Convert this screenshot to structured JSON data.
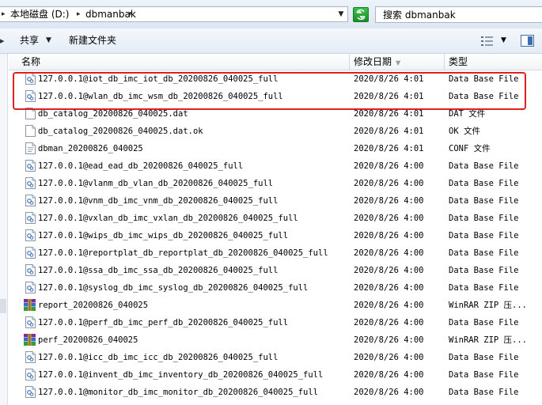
{
  "address": {
    "segments": [
      "本地磁盘 (D:)",
      "dbmanbak"
    ]
  },
  "search": {
    "label": "搜索",
    "query": "dbmanbak"
  },
  "toolbar": {
    "share": "共享",
    "new_folder": "新建文件夹"
  },
  "columns": {
    "name": "名称",
    "date": "修改日期",
    "type": "类型"
  },
  "files": [
    {
      "name": "127.0.0.1@iot_db_imc_iot_db_20200826_040025_full",
      "date": "2020/8/26 4:01",
      "type": "Data Base File",
      "icon": "db-file-icon"
    },
    {
      "name": "127.0.0.1@wlan_db_imc_wsm_db_20200826_040025_full",
      "date": "2020/8/26 4:01",
      "type": "Data Base File",
      "icon": "db-file-icon"
    },
    {
      "name": "db_catalog_20200826_040025.dat",
      "date": "2020/8/26 4:01",
      "type": "DAT 文件",
      "icon": "blank-file-icon"
    },
    {
      "name": "db_catalog_20200826_040025.dat.ok",
      "date": "2020/8/26 4:01",
      "type": "OK 文件",
      "icon": "blank-file-icon"
    },
    {
      "name": "dbman_20200826_040025",
      "date": "2020/8/26 4:01",
      "type": "CONF 文件",
      "icon": "conf-file-icon"
    },
    {
      "name": "127.0.0.1@ead_ead_db_20200826_040025_full",
      "date": "2020/8/26 4:00",
      "type": "Data Base File",
      "icon": "db-file-icon"
    },
    {
      "name": "127.0.0.1@vlanm_db_vlan_db_20200826_040025_full",
      "date": "2020/8/26 4:00",
      "type": "Data Base File",
      "icon": "db-file-icon"
    },
    {
      "name": "127.0.0.1@vnm_db_imc_vnm_db_20200826_040025_full",
      "date": "2020/8/26 4:00",
      "type": "Data Base File",
      "icon": "db-file-icon"
    },
    {
      "name": "127.0.0.1@vxlan_db_imc_vxlan_db_20200826_040025_full",
      "date": "2020/8/26 4:00",
      "type": "Data Base File",
      "icon": "db-file-icon"
    },
    {
      "name": "127.0.0.1@wips_db_imc_wips_db_20200826_040025_full",
      "date": "2020/8/26 4:00",
      "type": "Data Base File",
      "icon": "db-file-icon"
    },
    {
      "name": "127.0.0.1@reportplat_db_reportplat_db_20200826_040025_full",
      "date": "2020/8/26 4:00",
      "type": "Data Base File",
      "icon": "db-file-icon"
    },
    {
      "name": "127.0.0.1@ssa_db_imc_ssa_db_20200826_040025_full",
      "date": "2020/8/26 4:00",
      "type": "Data Base File",
      "icon": "db-file-icon"
    },
    {
      "name": "127.0.0.1@syslog_db_imc_syslog_db_20200826_040025_full",
      "date": "2020/8/26 4:00",
      "type": "Data Base File",
      "icon": "db-file-icon"
    },
    {
      "name": "report_20200826_040025",
      "date": "2020/8/26 4:00",
      "type": "WinRAR ZIP 压...",
      "icon": "winrar-zip-icon"
    },
    {
      "name": "127.0.0.1@perf_db_imc_perf_db_20200826_040025_full",
      "date": "2020/8/26 4:00",
      "type": "Data Base File",
      "icon": "db-file-icon"
    },
    {
      "name": "perf_20200826_040025",
      "date": "2020/8/26 4:00",
      "type": "WinRAR ZIP 压...",
      "icon": "winrar-zip-icon"
    },
    {
      "name": "127.0.0.1@icc_db_imc_icc_db_20200826_040025_full",
      "date": "2020/8/26 4:00",
      "type": "Data Base File",
      "icon": "db-file-icon"
    },
    {
      "name": "127.0.0.1@invent_db_imc_inventory_db_20200826_040025_full",
      "date": "2020/8/26 4:00",
      "type": "Data Base File",
      "icon": "db-file-icon"
    },
    {
      "name": "127.0.0.1@monitor_db_imc_monitor_db_20200826_040025_full",
      "date": "2020/8/26 4:00",
      "type": "Data Base File",
      "icon": "db-file-icon"
    }
  ],
  "highlight_color": "#e02020"
}
